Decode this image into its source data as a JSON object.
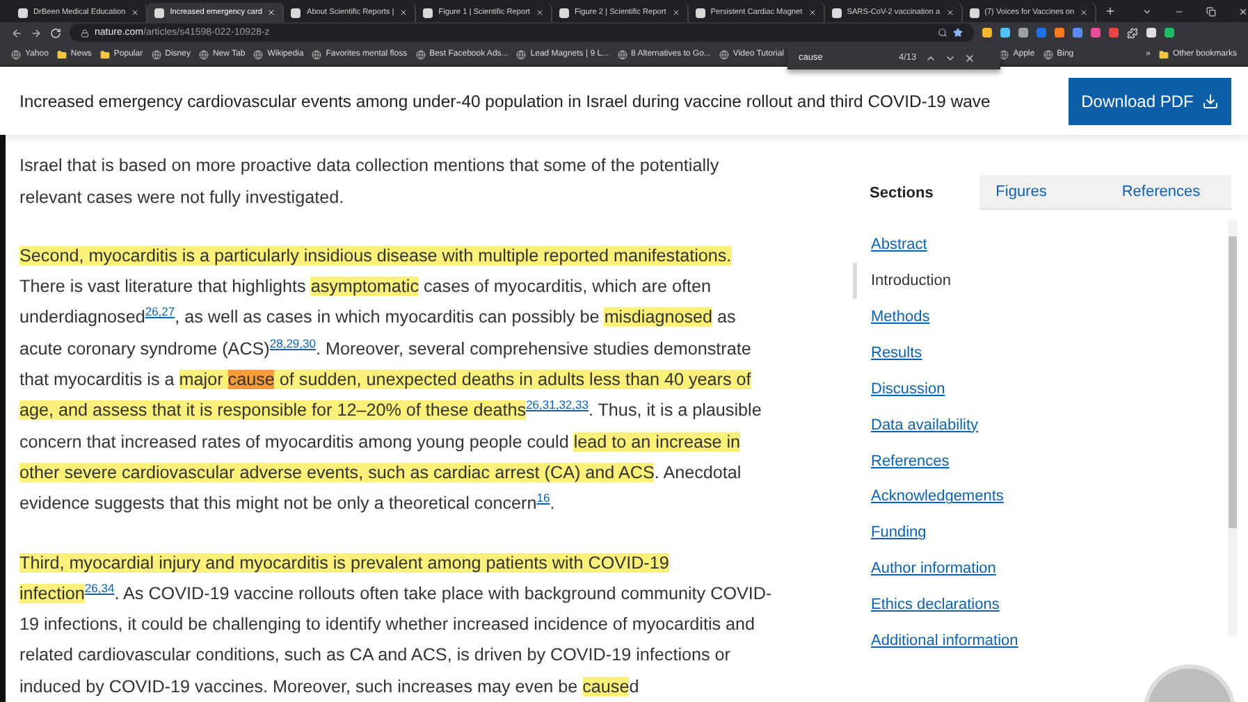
{
  "browser": {
    "tabs": [
      {
        "title": "DrBeen Medical Education",
        "selected": false
      },
      {
        "title": "Increased emergency card",
        "selected": true
      },
      {
        "title": "About Scientific Reports | ",
        "selected": false
      },
      {
        "title": "Figure 1 | Scientific Report",
        "selected": false
      },
      {
        "title": "Figure 2 | Scientific Report",
        "selected": false
      },
      {
        "title": "Persistent Cardiac Magnet",
        "selected": false
      },
      {
        "title": "SARS-CoV-2 vaccination a",
        "selected": false
      },
      {
        "title": "(7) Voices for Vaccines on",
        "selected": false
      }
    ],
    "address": {
      "host": "nature.com",
      "path": "/articles/s41598-022-10928-z"
    },
    "bookmarks": [
      "Yahoo",
      "News",
      "Popular",
      "Disney",
      "New Tab",
      "Wikipedia",
      "Favorites mental floss",
      "Best Facebook Ads...",
      "Lead Magnets | 9 L...",
      "8 Alternatives to Go...",
      "Video Tutorial"
    ],
    "bookmarks_right": [
      "Apple",
      "Bing"
    ],
    "bookmarks_more": "»",
    "other_bookmarks": "Other bookmarks",
    "find_bar": {
      "value": "cause",
      "count": "4/13"
    }
  },
  "header": {
    "title": "Increased emergency cardiovascular events among under-40 population in Israel during vaccine rollout and third COVID-19 wave",
    "download_button": "Download PDF"
  },
  "paragraphs": [
    {
      "segments": [
        {
          "kind": "text",
          "text": "Israel that is based on more proactive data collection mentions that some of the potentially relevant cases were not fully investigated."
        }
      ]
    },
    {
      "segments": [
        {
          "kind": "match",
          "text": "Second, myocarditis is a particularly insidious disease with multiple reported manifestations."
        },
        {
          "kind": "text",
          "text": " There is vast literature that highlights "
        },
        {
          "kind": "match",
          "text": "asymptomatic"
        },
        {
          "kind": "text",
          "text": " cases of myocarditis, which are often underdiagnosed"
        },
        {
          "kind": "ref",
          "text": "26,27"
        },
        {
          "kind": "text",
          "text": ", as well as cases in which myocarditis can possibly be "
        },
        {
          "kind": "match",
          "text": "misdiagnosed"
        },
        {
          "kind": "text",
          "text": " as acute coronary syndrome (ACS)"
        },
        {
          "kind": "ref",
          "text": "28,29,30"
        },
        {
          "kind": "text",
          "text": ". Moreover, several comprehensive studies demonstrate that myocarditis is a "
        },
        {
          "kind": "match",
          "text": "major "
        },
        {
          "kind": "current",
          "text": "cause"
        },
        {
          "kind": "match",
          "text": " of sudden, unexpected deaths in adults less than 40 years of age, and assess that it is responsible for 12–20% of these deaths"
        },
        {
          "kind": "ref",
          "text": "26,31,32,33"
        },
        {
          "kind": "text",
          "text": ". Thus, it is a plausible concern that increased rates of myocarditis among young people could "
        },
        {
          "kind": "match",
          "text": "lead to an increase in other severe cardiovascular adverse events, such as cardiac arrest (CA) and ACS"
        },
        {
          "kind": "text",
          "text": ". Anecdotal evidence suggests that this might not be only a theoretical concern"
        },
        {
          "kind": "ref",
          "text": "16"
        },
        {
          "kind": "text",
          "text": "."
        }
      ]
    },
    {
      "segments": [
        {
          "kind": "match",
          "text": "Third, myocardial injury and myocarditis is prevalent among patients with COVID-19 infection"
        },
        {
          "kind": "ref",
          "text": "26,34"
        },
        {
          "kind": "text",
          "text": ". As COVID-19 vaccine rollouts often take place with background community COVID-19 infections, it could be challenging to identify whether increased incidence of myocarditis and related cardiovascular conditions, such as CA and ACS, is driven by COVID-19 infections or induced by COVID-19 vaccines. Moreover, such increases may even be "
        },
        {
          "kind": "match",
          "text": "cause"
        },
        {
          "kind": "text",
          "text": "d"
        }
      ]
    }
  ],
  "sidebar": {
    "tabs": [
      {
        "label": "Sections",
        "selected": true
      },
      {
        "label": "Figures",
        "selected": false
      },
      {
        "label": "References",
        "selected": false
      }
    ],
    "sections": [
      {
        "label": "Abstract",
        "selected": false
      },
      {
        "label": "Introduction",
        "selected": true
      },
      {
        "label": "Methods",
        "selected": false
      },
      {
        "label": "Results",
        "selected": false
      },
      {
        "label": "Discussion",
        "selected": false
      },
      {
        "label": "Data availability",
        "selected": false
      },
      {
        "label": "References",
        "selected": false
      },
      {
        "label": "Acknowledgements",
        "selected": false
      },
      {
        "label": "Funding",
        "selected": false
      },
      {
        "label": "Author information",
        "selected": false
      },
      {
        "label": "Ethics declarations",
        "selected": false
      },
      {
        "label": "Additional information",
        "selected": false
      }
    ]
  }
}
